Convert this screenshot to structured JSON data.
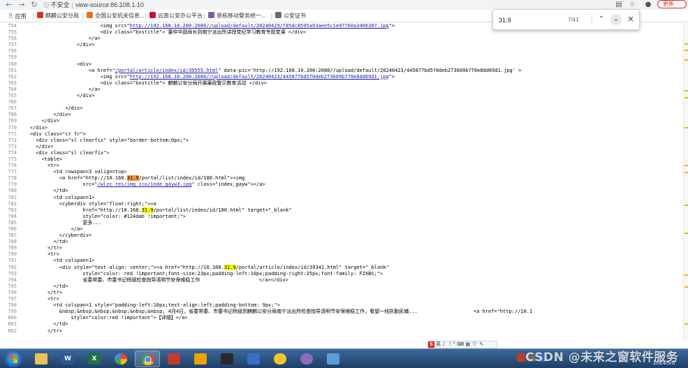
{
  "browser": {
    "security_label": "不安全",
    "url": "view-source:86.108.1.10",
    "update_label": "更新"
  },
  "bookmarks": [
    {
      "label": "应用",
      "color": "#1a73e8"
    },
    {
      "label": "麒麟公安分局",
      "color": "#d93025"
    },
    {
      "label": "全国公安机关信息...",
      "color": "#e8711a"
    },
    {
      "label": "云南公安办公平台",
      "color": "#c8102e"
    },
    {
      "label": "景栋移动警务统一...",
      "color": "#7b5ea7"
    },
    {
      "label": "公安证书",
      "color": "#6d6d6d"
    }
  ],
  "find": {
    "query": "31.9",
    "count": "7/41"
  },
  "source_lines": [
    {
      "n": "754",
      "i": 28,
      "parts": [
        {
          "t": "<img src=\""
        },
        {
          "t": "http://192.168.10.200:2080//upload/default/20240429/f85dc8595a93aee5c1e97760a3406307.jpg",
          "c": "lnk"
        },
        {
          "t": "\">"
        }
      ]
    },
    {
      "n": "755",
      "i": 28,
      "parts": [
        {
          "t": "<div class=\"bxstitle\"> 董仲华副局长到南宁派出所讲授党纪学习教育专题党课 </div>"
        }
      ]
    },
    {
      "n": "756",
      "i": 24,
      "parts": [
        {
          "t": "</a>"
        }
      ]
    },
    {
      "n": "757",
      "i": 20,
      "parts": [
        {
          "t": "</div>"
        }
      ]
    },
    {
      "n": "758",
      "i": 0,
      "parts": [
        {
          "t": ""
        }
      ]
    },
    {
      "n": "759",
      "i": 0,
      "parts": [
        {
          "t": ""
        }
      ]
    },
    {
      "n": "760",
      "i": 20,
      "parts": [
        {
          "t": "<div>"
        }
      ]
    },
    {
      "n": "761",
      "i": 24,
      "parts": [
        {
          "t": "<a href=\""
        },
        {
          "t": "/portal/article/index/id/39555.html",
          "c": "lnk"
        },
        {
          "t": "\" data-pic='http://192.168.10.200:2080//upload/default/20240423/445877bd5f0deb273609b770e8dd69d1.jpg' >"
        }
      ]
    },
    {
      "n": "762",
      "i": 28,
      "parts": [
        {
          "t": "<img src=\""
        },
        {
          "t": "http://192.168.10.200:2080//upload/default/20240423/445877bd5f0deb273609b770e8dd69d1.jpg",
          "c": "lnk"
        },
        {
          "t": "\">"
        }
      ]
    },
    {
      "n": "763",
      "i": 28,
      "parts": [
        {
          "t": "<div class=\"bxstitle\"> 麒麟公安分局开展廉政警示教育活动 </div>"
        }
      ]
    },
    {
      "n": "764",
      "i": 24,
      "parts": [
        {
          "t": "</a>"
        }
      ]
    },
    {
      "n": "765",
      "i": 20,
      "parts": [
        {
          "t": "</div>"
        }
      ]
    },
    {
      "n": "766",
      "i": 0,
      "parts": [
        {
          "t": ""
        }
      ]
    },
    {
      "n": "767",
      "i": 16,
      "parts": [
        {
          "t": "</div>"
        }
      ]
    },
    {
      "n": "768",
      "i": 12,
      "parts": [
        {
          "t": "</div>"
        }
      ]
    },
    {
      "n": "769",
      "i": 8,
      "parts": [
        {
          "t": "</div>"
        }
      ]
    },
    {
      "n": "770",
      "i": 4,
      "parts": [
        {
          "t": "</div>"
        }
      ]
    },
    {
      "n": "771",
      "i": 4,
      "parts": [
        {
          "t": "<div class=\"cr fr\">"
        }
      ]
    },
    {
      "n": "772",
      "i": 6,
      "parts": [
        {
          "t": "<div class=\"sl clearfix\" style=\"border-bottom:0px;\">"
        }
      ]
    },
    {
      "n": "773",
      "i": 6,
      "parts": [
        {
          "t": "</div>"
        }
      ]
    },
    {
      "n": "774",
      "i": 6,
      "parts": [
        {
          "t": "<div class=\"sl clearfix\">"
        }
      ]
    },
    {
      "n": "775",
      "i": 8,
      "parts": [
        {
          "t": "<table>"
        }
      ]
    },
    {
      "n": "776",
      "i": 10,
      "parts": [
        {
          "t": "<tr>"
        }
      ]
    },
    {
      "n": "777",
      "i": 12,
      "parts": [
        {
          "t": "<td rowspan=3 valign=top>"
        }
      ]
    },
    {
      "n": "778",
      "i": 14,
      "parts": [
        {
          "t": "<a href=\"http://10.168."
        },
        {
          "t": "31.9",
          "c": "hl"
        },
        {
          "t": "/portal/list/index/id/180.html\"><img"
        }
      ]
    },
    {
      "n": "779",
      "i": 22,
      "parts": [
        {
          "t": "src=\""
        },
        {
          "t": "/wlzc_res/img_ico/inde_gayw3.jpg",
          "c": "lnk"
        },
        {
          "t": "\" class=\"index_gayw\"></a>"
        }
      ]
    },
    {
      "n": "780",
      "i": 12,
      "parts": [
        {
          "t": "</td>"
        }
      ]
    },
    {
      "n": "781",
      "i": 12,
      "parts": [
        {
          "t": "<td colspan=1>"
        }
      ]
    },
    {
      "n": "782",
      "i": 14,
      "parts": [
        {
          "t": "<cyberdiv style=\"float:right;\"><a"
        }
      ]
    },
    {
      "n": "783",
      "i": 22,
      "parts": [
        {
          "t": "href=\"http://10.168."
        },
        {
          "t": "31.9",
          "c": "hl2"
        },
        {
          "t": "/portal/list/index/id/180.html\" target=\"_blank\""
        }
      ]
    },
    {
      "n": "784",
      "i": 22,
      "parts": [
        {
          "t": "style=\"color: #124dab !important;\">"
        }
      ]
    },
    {
      "n": "785",
      "i": 22,
      "parts": [
        {
          "t": "更多..."
        }
      ]
    },
    {
      "n": "786",
      "i": 18,
      "parts": [
        {
          "t": "</a>"
        }
      ]
    },
    {
      "n": "787",
      "i": 14,
      "parts": [
        {
          "t": "</cyberdiv>"
        }
      ]
    },
    {
      "n": "788",
      "i": 12,
      "parts": [
        {
          "t": "</td>"
        }
      ]
    },
    {
      "n": "789",
      "i": 10,
      "parts": [
        {
          "t": "</tr>"
        }
      ]
    },
    {
      "n": "790",
      "i": 10,
      "parts": [
        {
          "t": "<tr>"
        }
      ]
    },
    {
      "n": "791",
      "i": 12,
      "parts": [
        {
          "t": "<td colspan=1>"
        }
      ]
    },
    {
      "n": "792",
      "i": 14,
      "parts": [
        {
          "t": "<div style=\"text-align: center;\"><a href=\"http://10.168."
        },
        {
          "t": "31.9",
          "c": "hl2"
        },
        {
          "t": "/portal/article/index/id/39341.html\" target=\"_blank\""
        }
      ]
    },
    {
      "n": "793",
      "i": 22,
      "parts": [
        {
          "t": "style=\"color: red !important;font-size:23px;padding-left:10px;padding-right:25px;font-family: FZXBS;\">"
        }
      ]
    },
    {
      "n": "794",
      "i": 22,
      "parts": [
        {
          "t": "省委常委、市委书记杨斌检查指导清明节安保维稳工作                    </a></div>"
        }
      ]
    },
    {
      "n": "795",
      "i": 12,
      "parts": [
        {
          "t": "</td>"
        }
      ]
    },
    {
      "n": "796",
      "i": 10,
      "parts": [
        {
          "t": "</tr>"
        }
      ]
    },
    {
      "n": "797",
      "i": 10,
      "parts": [
        {
          "t": "<tr>"
        }
      ]
    },
    {
      "n": "798",
      "i": 12,
      "parts": [
        {
          "t": "<td colspan=1 style=\"padding-left:10px;text-align:left;padding-bottom: 9px;\">"
        }
      ]
    },
    {
      "n": "799",
      "i": 14,
      "parts": [
        {
          "t": "&nbsp;&nbsp;&nbsp;&nbsp;&nbsp;&nbsp; 4月4日，省委常委、市委书记杨斌到麒麟公安分局南宁派出所检查指导清明节安保维稳工作，看望一线执勤民辅...                   <a href=\"http://10.1"
        }
      ]
    },
    {
      "n": "800",
      "i": 18,
      "parts": [
        {
          "t": "style=\"color:red !important\">【详细】</a>"
        }
      ]
    },
    {
      "n": "801",
      "i": 12,
      "parts": [
        {
          "t": "</td>"
        }
      ]
    },
    {
      "n": "802",
      "i": 10,
      "parts": [
        {
          "t": "</tr>"
        }
      ]
    }
  ],
  "ime": {
    "logo": "S",
    "label": "英",
    "icons": "♪ ☽ ° ⌨ ▦ 👕 ✎"
  },
  "tray_date": "2024/5/6",
  "watermark": "CSDN @未来之窗软件服务",
  "colors": {
    "find_highlight_current": "#ff9632",
    "find_highlight_other": "#ffff00",
    "link": "#1a1aa6",
    "update_red": "#d93025"
  }
}
